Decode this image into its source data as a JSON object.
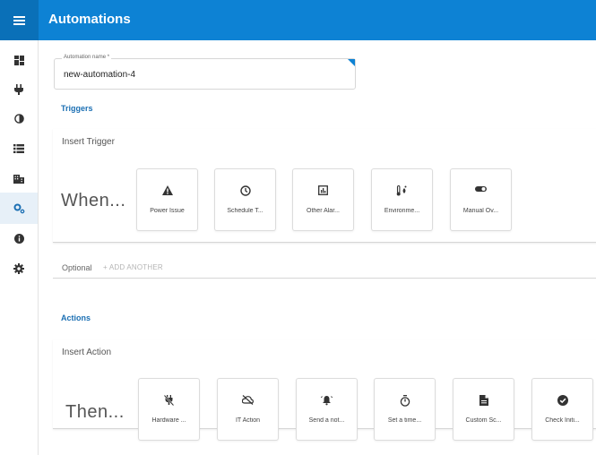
{
  "header": {
    "title": "Automations",
    "menu_icon": "hamburger-icon",
    "color": "#0d82d4"
  },
  "sidebar": {
    "items": [
      {
        "icon": "dashboard-icon",
        "active": false
      },
      {
        "icon": "plug-icon",
        "active": false
      },
      {
        "icon": "contrast-icon",
        "active": false
      },
      {
        "icon": "list-icon",
        "active": false
      },
      {
        "icon": "building-icon",
        "active": false
      },
      {
        "icon": "cogs-icon",
        "active": true
      },
      {
        "icon": "info-icon",
        "active": false
      },
      {
        "icon": "settings-icon",
        "active": false
      }
    ]
  },
  "form": {
    "name_label": "Automation name *",
    "name_value": "new-automation-4"
  },
  "triggers": {
    "heading": "Triggers",
    "panel_title": "Insert Trigger",
    "lead": "When...",
    "cards": [
      {
        "icon": "warning-icon",
        "label": "Power Issue"
      },
      {
        "icon": "clock-icon",
        "label": "Schedule T..."
      },
      {
        "icon": "chart-icon",
        "label": "Other Alar..."
      },
      {
        "icon": "environment-icon",
        "label": "Environme..."
      },
      {
        "icon": "toggle-icon",
        "label": "Manual Ov..."
      }
    ],
    "optional_label": "Optional",
    "add_another": "+ ADD ANOTHER"
  },
  "actions": {
    "heading": "Actions",
    "panel_title": "Insert Action",
    "lead": "Then...",
    "cards": [
      {
        "icon": "no-power-icon",
        "label": "Hardware ..."
      },
      {
        "icon": "cloud-off-icon",
        "label": "IT Action"
      },
      {
        "icon": "bell-icon",
        "label": "Send a not..."
      },
      {
        "icon": "timer-icon",
        "label": "Set a time..."
      },
      {
        "icon": "file-icon",
        "label": "Custom Sc..."
      },
      {
        "icon": "check-circle-icon",
        "label": "Check Initi..."
      }
    ]
  }
}
